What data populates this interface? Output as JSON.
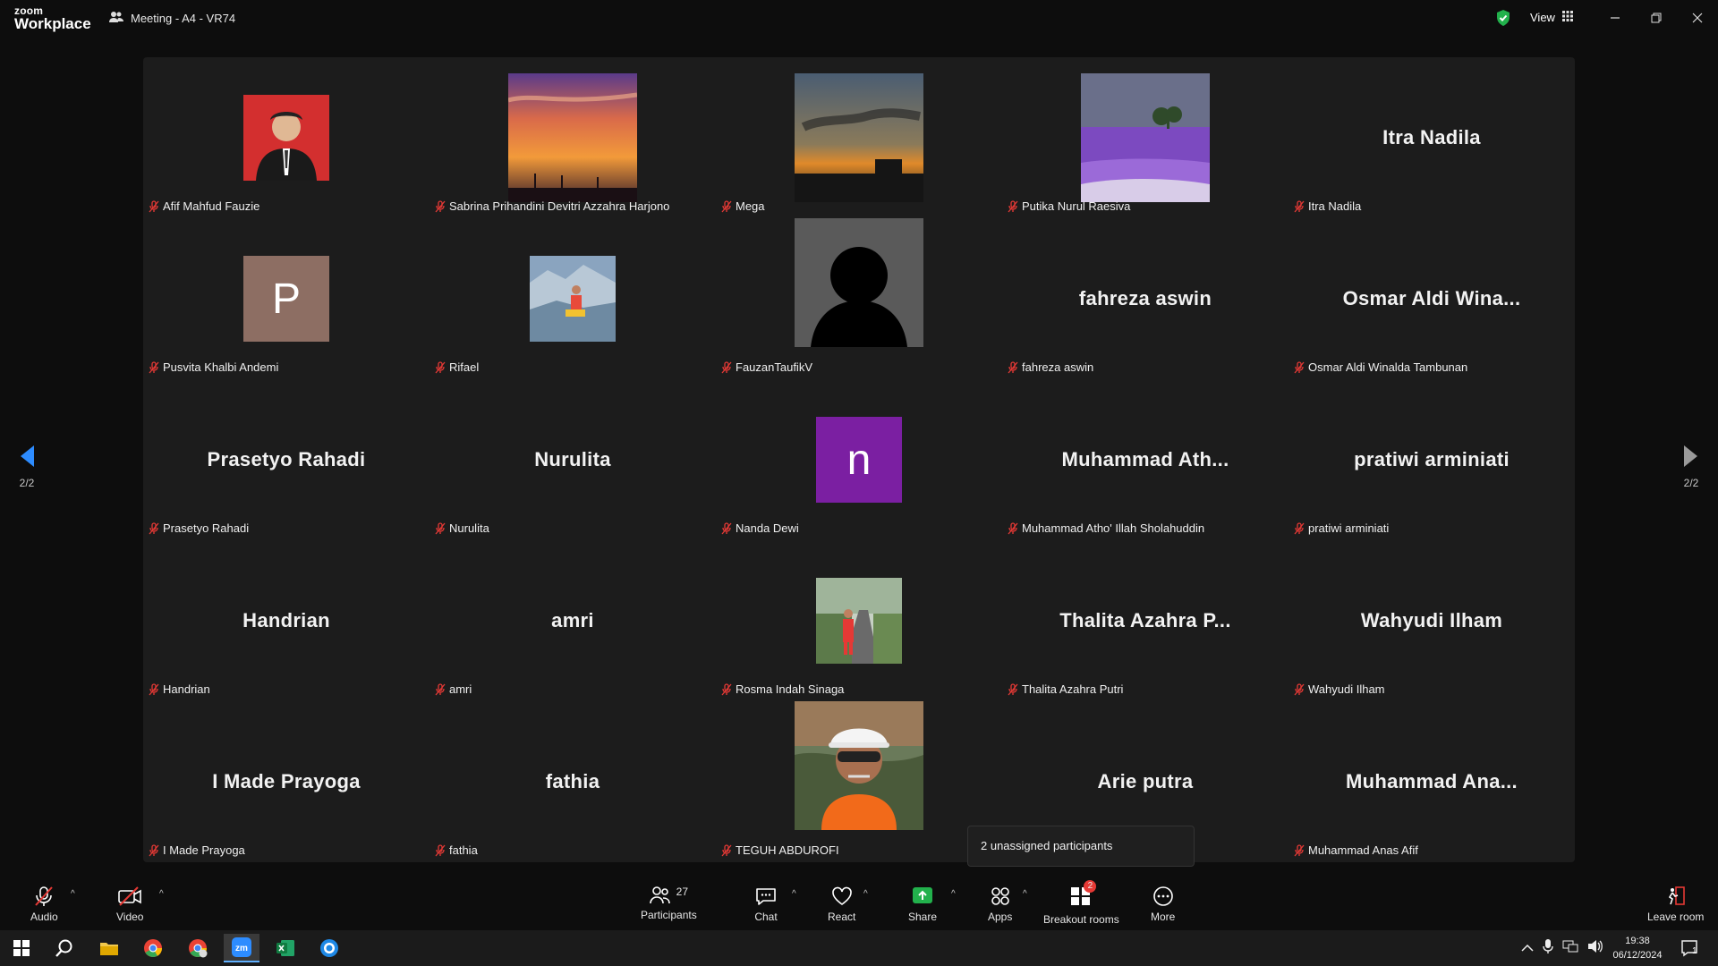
{
  "app": {
    "brand_top": "zoom",
    "brand_bottom": "Workplace",
    "meeting_title": "Meeting - A4 - VR74",
    "view_label": "View"
  },
  "gallery": {
    "page_indicator_left": "2/2",
    "page_indicator_right": "2/2",
    "participants": [
      {
        "name": "Afif Mahfud Fauzie",
        "display": "photo"
      },
      {
        "name": "Sabrina Prihandini Devitri Azzahra Harjono",
        "display": "photo"
      },
      {
        "name": "Mega",
        "display": "photo"
      },
      {
        "name": "Putika Nurul Raesiva",
        "display": "photo"
      },
      {
        "name": "Itra Nadila",
        "display": "name",
        "big_name": "Itra Nadila"
      },
      {
        "name": "Pusvita Khalbi Andemi",
        "display": "avatar",
        "initial": "P"
      },
      {
        "name": "Rifael",
        "display": "photo"
      },
      {
        "name": "FauzanTaufikV",
        "display": "silhouette"
      },
      {
        "name": "fahreza aswin",
        "display": "name",
        "big_name": "fahreza aswin"
      },
      {
        "name": "Osmar Aldi Winalda Tambunan",
        "display": "name",
        "big_name": "Osmar  Aldi  Wina..."
      },
      {
        "name": "Prasetyo Rahadi",
        "display": "name",
        "big_name": "Prasetyo Rahadi"
      },
      {
        "name": "Nurulita",
        "display": "name",
        "big_name": "Nurulita"
      },
      {
        "name": "Nanda Dewi",
        "display": "avatar",
        "initial": "n"
      },
      {
        "name": "Muhammad Atho' Illah Sholahuddin",
        "display": "name",
        "big_name": "Muhammad  Ath..."
      },
      {
        "name": "pratiwi arminiati",
        "display": "name",
        "big_name": "pratiwi arminiati"
      },
      {
        "name": "Handrian",
        "display": "name",
        "big_name": "Handrian"
      },
      {
        "name": "amri",
        "display": "name",
        "big_name": "amri"
      },
      {
        "name": "Rosma Indah Sinaga",
        "display": "photo"
      },
      {
        "name": "Thalita Azahra Putri",
        "display": "name",
        "big_name": "Thalita Azahra P..."
      },
      {
        "name": "Wahyudi Ilham",
        "display": "name",
        "big_name": "Wahyudi Ilham"
      },
      {
        "name": "I Made Prayoga",
        "display": "name",
        "big_name": "I Made Prayoga"
      },
      {
        "name": "fathia",
        "display": "name",
        "big_name": "fathia"
      },
      {
        "name": "TEGUH ABDUROFI",
        "display": "photo"
      },
      {
        "name": "Arie putra",
        "display": "name",
        "big_name": "Arie putra"
      },
      {
        "name": "Muhammad Anas Afif",
        "display": "name",
        "big_name": "Muhammad  Ana..."
      }
    ]
  },
  "popup": {
    "text": "2 unassigned participants"
  },
  "toolbar": {
    "audio": "Audio",
    "video": "Video",
    "participants": "Participants",
    "participants_count": "27",
    "chat": "Chat",
    "react": "React",
    "share": "Share",
    "apps": "Apps",
    "breakout": "Breakout rooms",
    "breakout_badge": "2",
    "more": "More",
    "leave": "Leave room"
  },
  "taskbar": {
    "time": "19:38",
    "date": "06/12/2024",
    "notification_count": "1"
  },
  "colors": {
    "share_green": "#22b14c",
    "accent_blue": "#2d8cff",
    "mic_red": "#e53935",
    "avatar_brown": "#8d6e63",
    "avatar_purple": "#7b1fa2"
  }
}
